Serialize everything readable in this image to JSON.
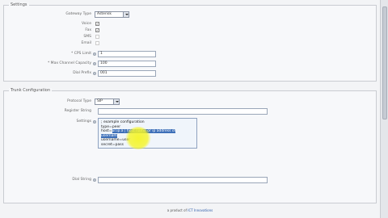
{
  "settings": {
    "legend": "Settings",
    "gateway_type_label": "Gateway Type",
    "gateway_type_value": "Asterisk",
    "voice_label": "Voice",
    "voice_checked": "✓",
    "fax_label": "Fax",
    "fax_checked": "✓",
    "sms_label": "SMS",
    "email_label": "Email",
    "cps_limit_label": "* CPS Limit",
    "cps_limit_value": "1",
    "max_channels_label": "* Max Channel Capacity",
    "max_channels_value": "100",
    "dial_prefix_label": "Dial Prefix",
    "dial_prefix_value": "001"
  },
  "trunk": {
    "legend": "Trunk Configuration",
    "protocol_label": "Protocol Type",
    "protocol_value": "SIP",
    "register_string_label": "Register String",
    "register_string_value": "",
    "settings_label": "Settings",
    "settings_lines": [
      "; example configuration",
      "type=peer",
      "host=",
      "username",
      "username=user",
      "secret=pass"
    ],
    "settings_hl_line3": "host=",
    "settings_hl_line3_tail": "ur.ip.a | host name or ip address of",
    "settings_hl_line4": "username",
    "dial_string_label": "Dial String",
    "dial_string_value": ""
  },
  "footer": {
    "prefix": "a product of",
    "company": "ICT Innovations"
  }
}
